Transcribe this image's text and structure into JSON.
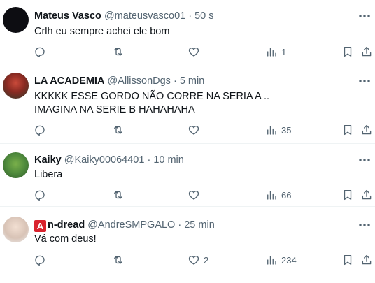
{
  "tweets": [
    {
      "name": "Mateus Vasco",
      "handle": "@mateusvasco01",
      "time": "· 50 s",
      "text_lines": [
        "Crlh eu sempre achei ele bom"
      ],
      "likes": "",
      "views": "1"
    },
    {
      "name": "LA ACADEMIA",
      "handle": "@AllissonDgs",
      "time": "· 5 min",
      "text_lines": [
        "KKKKK ESSE GORDO NÃO CORRE NA SERIA A ..",
        "IMAGINA NA SERIE B HAHAHAHA"
      ],
      "likes": "",
      "views": "35"
    },
    {
      "name": "Kaiky",
      "handle": "@Kaiky00064401",
      "time": "· 10 min",
      "text_lines": [
        "Libera"
      ],
      "likes": "",
      "views": "66"
    },
    {
      "name_badge": "A",
      "name": "n-dread",
      "handle": "@AndreSMPGALO",
      "time": "· 25 min",
      "text_lines": [
        "Vá com deus!"
      ],
      "likes": "2",
      "views": "234"
    }
  ],
  "icons": {
    "more": "more-dots-icon",
    "reply": "reply-icon",
    "retweet": "retweet-icon",
    "like": "heart-icon",
    "views": "views-chart-icon",
    "bookmark": "bookmark-icon",
    "share": "share-icon"
  },
  "colors": {
    "text": "#0f1419",
    "secondary": "#536471",
    "divider": "#eff3f4",
    "badge": "#d9232e"
  }
}
